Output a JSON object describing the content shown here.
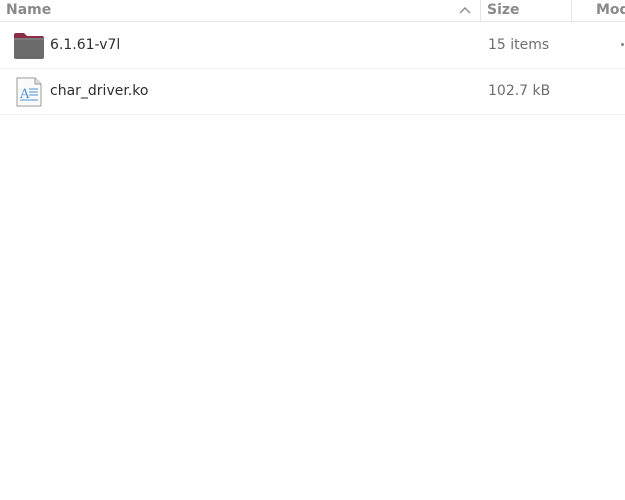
{
  "header": {
    "name_label": "Name",
    "size_label": "Size",
    "modified_label": "Mod"
  },
  "rows": [
    {
      "name": "6.1.61-v7l",
      "size": "15 items",
      "icon": "folder-icon"
    },
    {
      "name": "char_driver.ko",
      "size": "102.7 kB",
      "icon": "text-file-icon"
    }
  ],
  "colors": {
    "folder_tab": "#8e2d4a",
    "folder_body": "#6b6b6b",
    "header_text": "#8a8a8a",
    "file_accent": "#4a90d9"
  }
}
